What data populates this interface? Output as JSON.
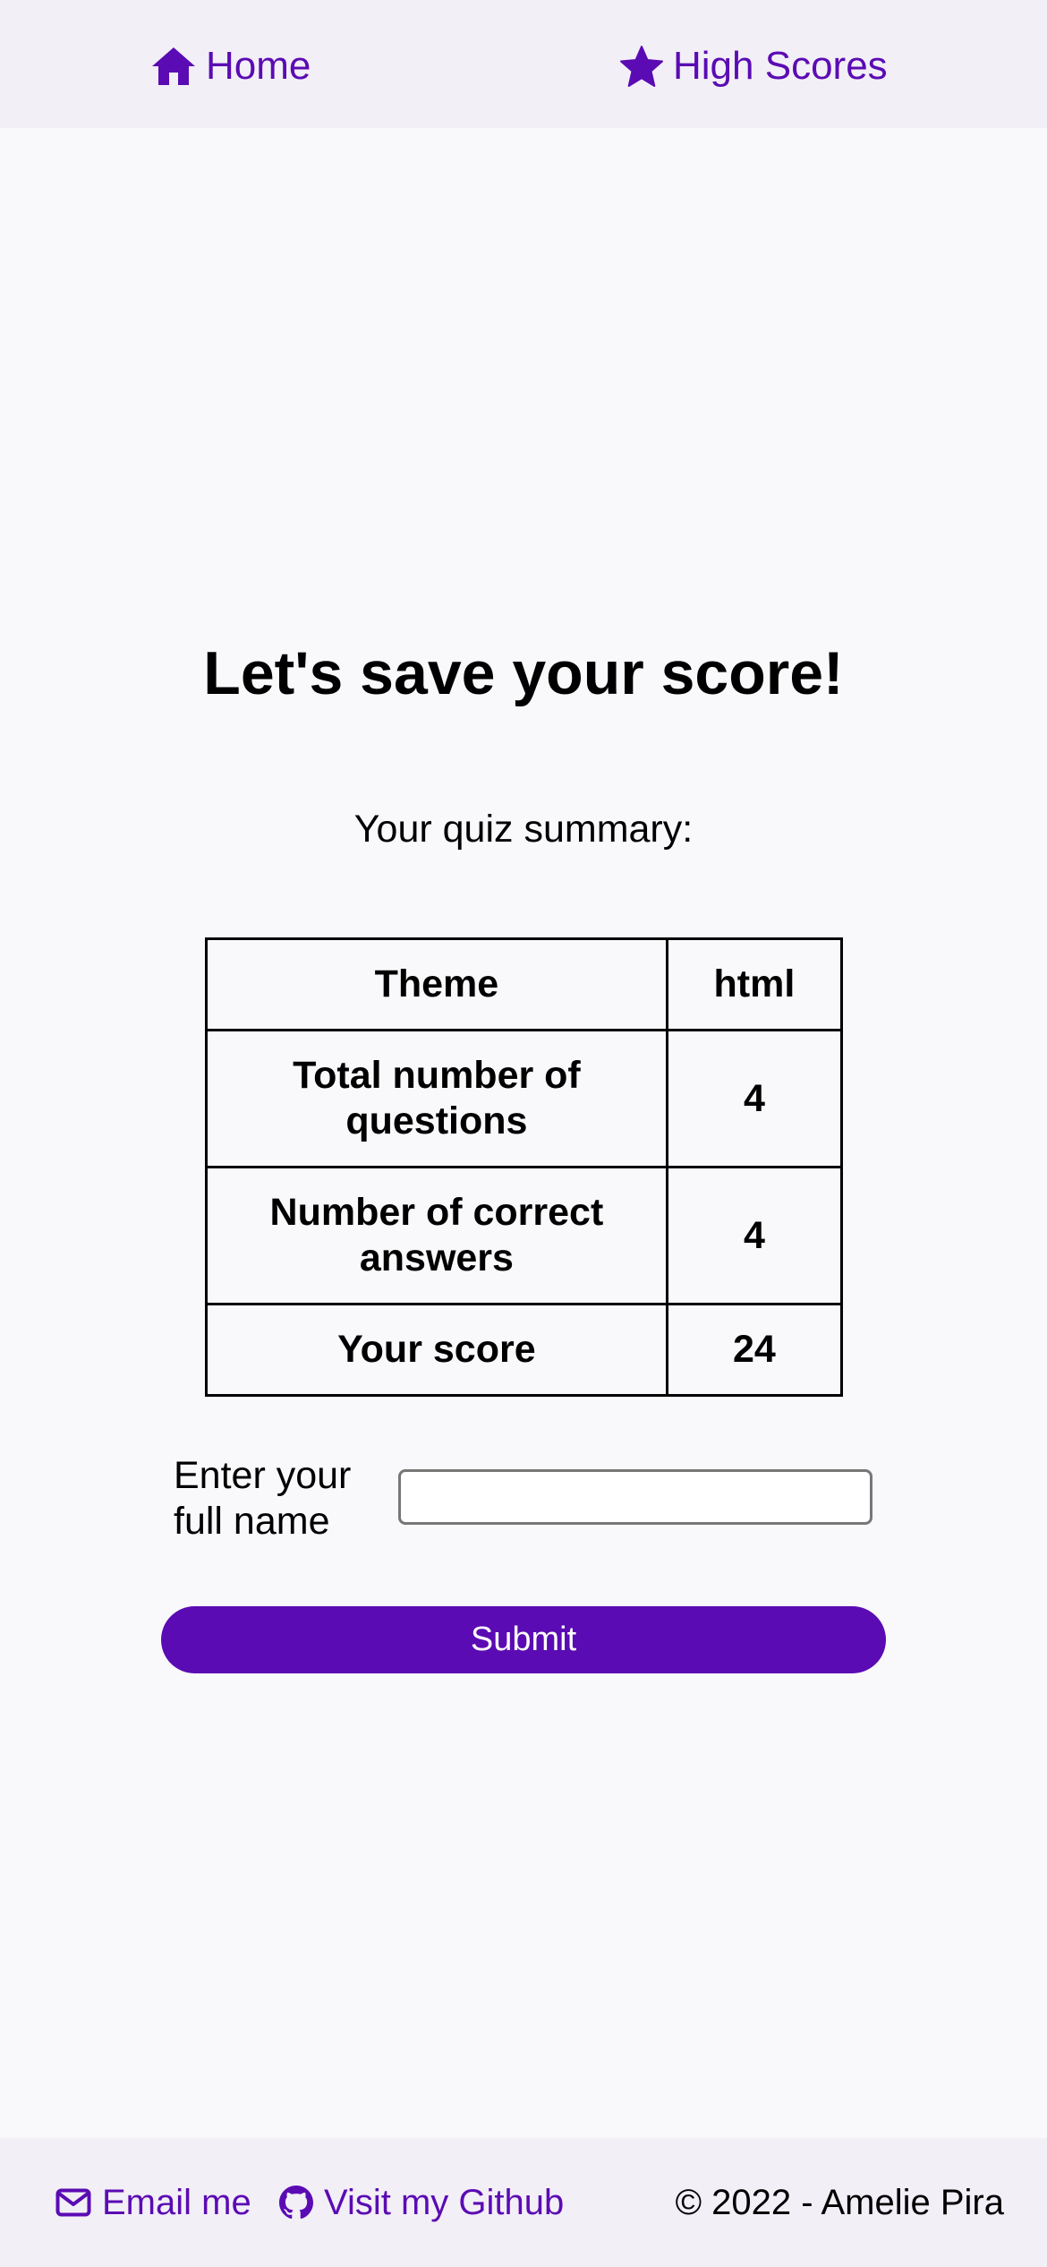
{
  "nav": {
    "home_label": "Home",
    "home_icon": "home-icon",
    "high_scores_label": "High Scores",
    "high_scores_icon": "star-icon"
  },
  "main": {
    "title": "Let's save your score!",
    "summary_label": "Your quiz summary:",
    "summary_rows": [
      {
        "label": "Theme",
        "value": "html"
      },
      {
        "label": "Total number of questions",
        "value": "4"
      },
      {
        "label": "Number of correct answers",
        "value": "4"
      },
      {
        "label": "Your score",
        "value": "24"
      }
    ],
    "name_label": "Enter your full name",
    "name_value": "",
    "name_placeholder": "",
    "submit_label": "Submit"
  },
  "footer": {
    "email_label": "Email me",
    "email_icon": "envelope-icon",
    "github_label": "Visit my Github",
    "github_icon": "github-icon",
    "copyright": "© 2022 - Amelie Pira"
  },
  "colors": {
    "accent": "#5b0bb3",
    "nav_background": "#f2eff7",
    "page_background": "#f9f9fc"
  }
}
